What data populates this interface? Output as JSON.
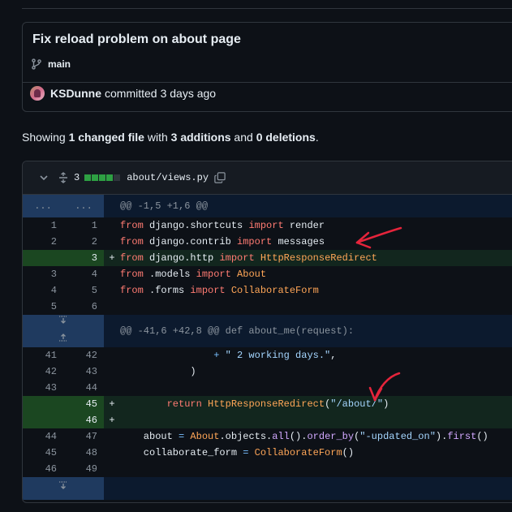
{
  "commit": {
    "title": "Fix reload problem on about page",
    "branch": "main",
    "author": "KSDunne",
    "action": "committed",
    "time": "3 days ago"
  },
  "summary": {
    "prefix": "Showing ",
    "files": "1 changed file",
    "with": " with ",
    "additions": "3 additions",
    "and": " and ",
    "deletions": "0 deletions",
    "suffix": "."
  },
  "file": {
    "change_count": "3",
    "name": "about/views.py",
    "diffstat_colors": [
      "#2ea043",
      "#2ea043",
      "#2ea043",
      "#2ea043",
      "#30363d"
    ]
  },
  "diff": {
    "hunk1": {
      "left": "...",
      "right": "...",
      "text": "@@ -1,5 +1,6 @@"
    },
    "hunk2": {
      "text": "@@ -41,6 +42,8 @@ def about_me(request):"
    },
    "lines": [
      {
        "old": "1",
        "new": "1",
        "sign": "",
        "type": "context",
        "parts": [
          [
            "kw",
            "from"
          ],
          [
            "",
            " django.shortcuts "
          ],
          [
            "kw",
            "import"
          ],
          [
            "",
            " render"
          ]
        ]
      },
      {
        "old": "2",
        "new": "2",
        "sign": "",
        "type": "context",
        "parts": [
          [
            "kw",
            "from"
          ],
          [
            "",
            " django.contrib "
          ],
          [
            "kw",
            "import"
          ],
          [
            "",
            " messages"
          ]
        ]
      },
      {
        "old": "",
        "new": "3",
        "sign": "+",
        "type": "add",
        "parts": [
          [
            "kw",
            "from"
          ],
          [
            "",
            " django.http "
          ],
          [
            "kw",
            "import"
          ],
          [
            "",
            " "
          ],
          [
            "cls",
            "HttpResponseRedirect"
          ]
        ]
      },
      {
        "old": "3",
        "new": "4",
        "sign": "",
        "type": "context",
        "parts": [
          [
            "kw",
            "from"
          ],
          [
            "",
            " .models "
          ],
          [
            "kw",
            "import"
          ],
          [
            "",
            " "
          ],
          [
            "cls",
            "About"
          ]
        ]
      },
      {
        "old": "4",
        "new": "5",
        "sign": "",
        "type": "context",
        "parts": [
          [
            "kw",
            "from"
          ],
          [
            "",
            " .forms "
          ],
          [
            "kw",
            "import"
          ],
          [
            "",
            " "
          ],
          [
            "cls",
            "CollaborateForm"
          ]
        ]
      },
      {
        "old": "5",
        "new": "6",
        "sign": "",
        "type": "context",
        "parts": []
      }
    ],
    "lines2": [
      {
        "old": "41",
        "new": "42",
        "sign": "",
        "type": "context",
        "parts": [
          [
            "",
            "                "
          ],
          [
            "op",
            "+"
          ],
          [
            "str",
            " \" 2 working days.\""
          ],
          [
            "",
            ","
          ]
        ]
      },
      {
        "old": "42",
        "new": "43",
        "sign": "",
        "type": "context",
        "parts": [
          [
            "",
            "            )"
          ]
        ]
      },
      {
        "old": "43",
        "new": "44",
        "sign": "",
        "type": "context",
        "parts": []
      },
      {
        "old": "",
        "new": "45",
        "sign": "+",
        "type": "add",
        "parts": [
          [
            "",
            "        "
          ],
          [
            "kw",
            "return"
          ],
          [
            "",
            " "
          ],
          [
            "cls",
            "HttpResponseRedirect"
          ],
          [
            "",
            "("
          ],
          [
            "str",
            "\"/about/\""
          ],
          [
            "",
            ")"
          ]
        ]
      },
      {
        "old": "",
        "new": "46",
        "sign": "+",
        "type": "add",
        "parts": []
      },
      {
        "old": "44",
        "new": "47",
        "sign": "",
        "type": "context",
        "parts": [
          [
            "",
            "    about "
          ],
          [
            "op",
            "="
          ],
          [
            "",
            " "
          ],
          [
            "cls",
            "About"
          ],
          [
            "",
            ".objects."
          ],
          [
            "fn",
            "all"
          ],
          [
            "",
            "()."
          ],
          [
            "fn",
            "order_by"
          ],
          [
            "",
            "("
          ],
          [
            "str",
            "\"-updated_on\""
          ],
          [
            "",
            ")."
          ],
          [
            "fn",
            "first"
          ],
          [
            "",
            "()"
          ]
        ]
      },
      {
        "old": "45",
        "new": "48",
        "sign": "",
        "type": "context",
        "parts": [
          [
            "",
            "    collaborate_form "
          ],
          [
            "op",
            "="
          ],
          [
            "",
            " "
          ],
          [
            "cls",
            "CollaborateForm"
          ],
          [
            "",
            "()"
          ]
        ]
      },
      {
        "old": "46",
        "new": "49",
        "sign": "",
        "type": "context",
        "parts": []
      }
    ]
  },
  "colors": {
    "added_bg": "#12261e",
    "added_gutter": "#1b4721",
    "hunk_bg": "#0c1a2e",
    "hunk_gutter": "#1f3a5f",
    "annotation_arrow": "#e5243b"
  },
  "icons": [
    "git-branch-icon",
    "chevron-down-icon",
    "unfold-icon",
    "copy-icon",
    "expand-up-icon",
    "expand-down-icon"
  ]
}
